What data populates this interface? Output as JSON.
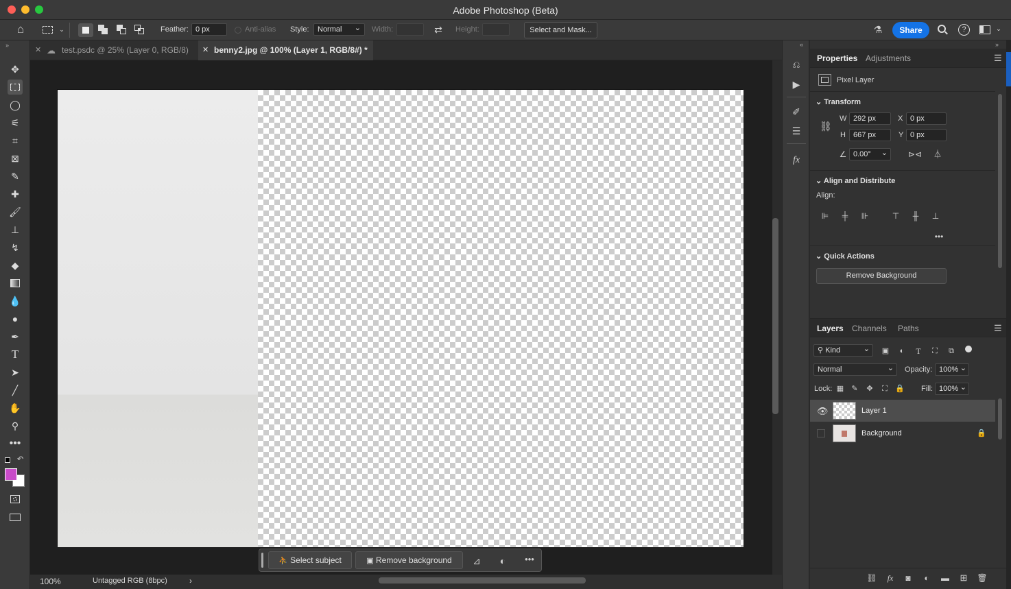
{
  "window": {
    "title": "Adobe Photoshop (Beta)",
    "traffic_colors": [
      "#fe5f57",
      "#febc2e",
      "#28c840"
    ]
  },
  "options_bar": {
    "feather_label": "Feather:",
    "feather_value": "0 px",
    "antialias_label": "Anti-alias",
    "style_label": "Style:",
    "style_value": "Normal",
    "width_label": "Width:",
    "height_label": "Height:",
    "select_mask_label": "Select and Mask...",
    "share_label": "Share",
    "share_color": "#1473e6"
  },
  "tabs": [
    {
      "label": "test.psdc @ 25% (Layer 0, RGB/8)",
      "active": false
    },
    {
      "label": "benny2.jpg @ 100% (Layer 1, RGB/8#) *",
      "active": true
    }
  ],
  "colors": {
    "foreground": "#c94bc9",
    "background": "#ffffff"
  },
  "context_bar": {
    "select_subject": "Select subject",
    "remove_background": "Remove background"
  },
  "status": {
    "zoom": "100%",
    "profile": "Untagged RGB (8bpc)"
  },
  "properties": {
    "tabs": [
      "Properties",
      "Adjustments"
    ],
    "layer_type": "Pixel Layer",
    "transform": {
      "title": "Transform",
      "w_label": "W",
      "w": "292 px",
      "h_label": "H",
      "h": "667 px",
      "x_label": "X",
      "x": "0 px",
      "y_label": "Y",
      "y": "0 px",
      "angle": "0.00°"
    },
    "align": {
      "title": "Align and Distribute",
      "label": "Align:"
    },
    "quick_actions": {
      "title": "Quick Actions",
      "remove_bg": "Remove Background"
    }
  },
  "layers_panel": {
    "tabs": [
      "Layers",
      "Channels",
      "Paths"
    ],
    "filter": "Kind",
    "blend": "Normal",
    "opacity_label": "Opacity:",
    "opacity": "100%",
    "lock_label": "Lock:",
    "fill_label": "Fill:",
    "fill": "100%",
    "layers": [
      {
        "name": "Layer 1",
        "visible": true,
        "selected": true
      },
      {
        "name": "Background",
        "visible": false,
        "locked": true
      }
    ]
  }
}
